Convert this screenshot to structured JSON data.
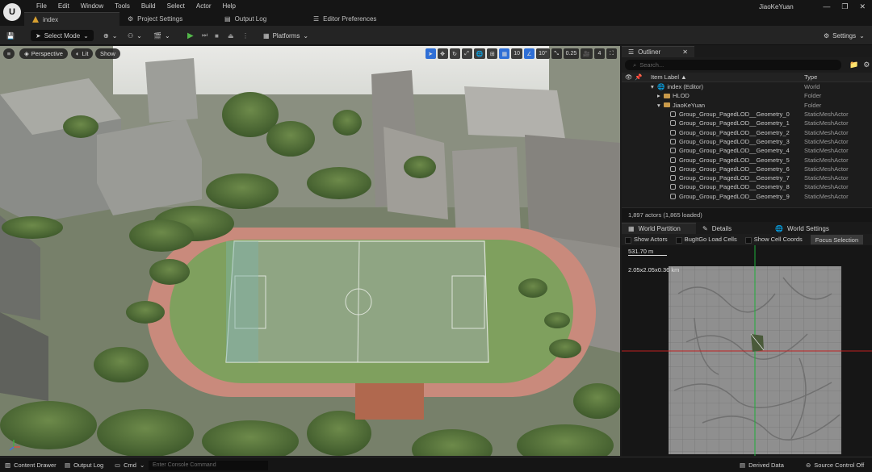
{
  "menu": {
    "items": [
      "File",
      "Edit",
      "Window",
      "Tools",
      "Build",
      "Select",
      "Actor",
      "Help"
    ],
    "user": "JiaoKeYuan"
  },
  "tabs": [
    {
      "label": "index",
      "icon": "level-icon"
    },
    {
      "label": "Project Settings",
      "icon": "gear-icon"
    },
    {
      "label": "Output Log",
      "icon": "log-icon"
    },
    {
      "label": "Editor Preferences",
      "icon": "sliders-icon"
    }
  ],
  "toolbar": {
    "select_mode": "Select Mode",
    "platforms": "Platforms",
    "settings": "Settings"
  },
  "viewport": {
    "perspective": "Perspective",
    "lit": "Lit",
    "show": "Show",
    "grid_value": "10",
    "angle_value": "10°",
    "scale_value": "0.25",
    "camera_speed": "4"
  },
  "outliner": {
    "title": "Outliner",
    "search_placeholder": "Search...",
    "col_label": "Item Label ▲",
    "col_type": "Type",
    "rows": [
      {
        "label": "index (Editor)",
        "type": "World",
        "indent": 1,
        "kind": "world"
      },
      {
        "label": "HLOD",
        "type": "Folder",
        "indent": 2,
        "kind": "folder"
      },
      {
        "label": "JiaoKeYuan",
        "type": "Folder",
        "indent": 2,
        "kind": "folder"
      },
      {
        "label": "Group_Group_PagedLOD__Geometry_0",
        "type": "StaticMeshActor",
        "indent": 3,
        "kind": "mesh"
      },
      {
        "label": "Group_Group_PagedLOD__Geometry_1",
        "type": "StaticMeshActor",
        "indent": 3,
        "kind": "mesh"
      },
      {
        "label": "Group_Group_PagedLOD__Geometry_2",
        "type": "StaticMeshActor",
        "indent": 3,
        "kind": "mesh"
      },
      {
        "label": "Group_Group_PagedLOD__Geometry_3",
        "type": "StaticMeshActor",
        "indent": 3,
        "kind": "mesh"
      },
      {
        "label": "Group_Group_PagedLOD__Geometry_4",
        "type": "StaticMeshActor",
        "indent": 3,
        "kind": "mesh"
      },
      {
        "label": "Group_Group_PagedLOD__Geometry_5",
        "type": "StaticMeshActor",
        "indent": 3,
        "kind": "mesh"
      },
      {
        "label": "Group_Group_PagedLOD__Geometry_6",
        "type": "StaticMeshActor",
        "indent": 3,
        "kind": "mesh"
      },
      {
        "label": "Group_Group_PagedLOD__Geometry_7",
        "type": "StaticMeshActor",
        "indent": 3,
        "kind": "mesh"
      },
      {
        "label": "Group_Group_PagedLOD__Geometry_8",
        "type": "StaticMeshActor",
        "indent": 3,
        "kind": "mesh"
      },
      {
        "label": "Group_Group_PagedLOD__Geometry_9",
        "type": "StaticMeshActor",
        "indent": 3,
        "kind": "mesh"
      }
    ],
    "actors_count": "1,897 actors (1,865 loaded)"
  },
  "world_partition": {
    "tabs": [
      "World Partition",
      "Details",
      "World Settings"
    ],
    "show_actors": "Show Actors",
    "bugit_go": "BugItGo Load Cells",
    "show_cell_coords": "Show Cell Coords",
    "focus_selection": "Focus Selection",
    "scale_label": "531.70 m",
    "cell_size": "2.05x2.05x0.36 km"
  },
  "statusbar": {
    "content_drawer": "Content Drawer",
    "output_log": "Output Log",
    "cmd": "Cmd",
    "console_placeholder": "Enter Console Command",
    "derived_data": "Derived Data",
    "source_control": "Source Control Off"
  },
  "colors": {
    "accent_blue": "#2f6fd6",
    "play_green": "#53b84a",
    "folder": "#c99a4a"
  }
}
